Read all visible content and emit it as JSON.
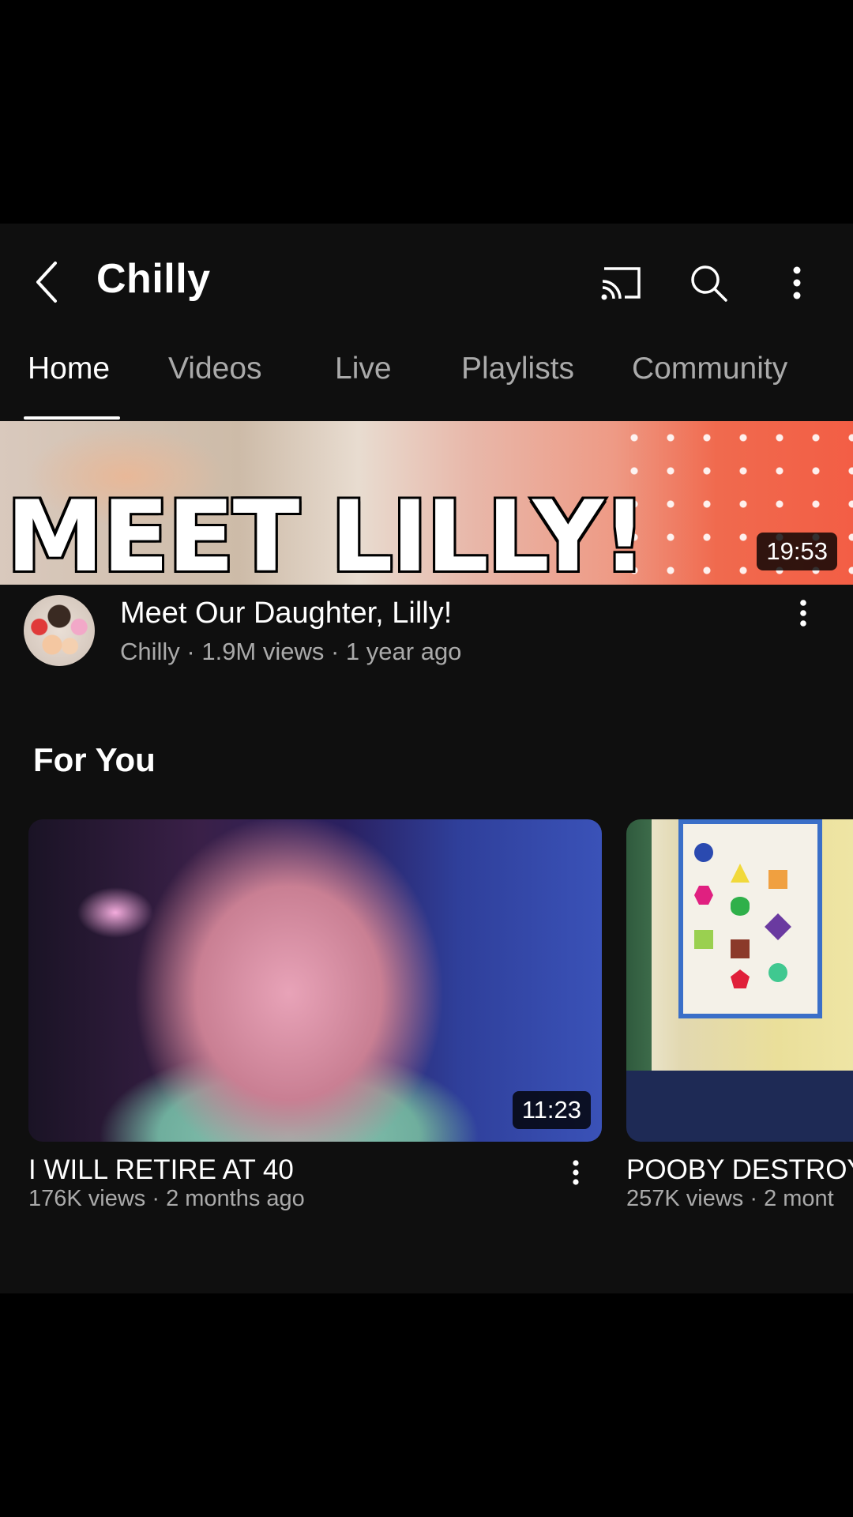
{
  "header": {
    "title": "Chilly",
    "icons": [
      "back-arrow-icon",
      "cast-icon",
      "search-icon",
      "more-vert-icon"
    ]
  },
  "tabs": [
    {
      "label": "Home",
      "active": true
    },
    {
      "label": "Videos",
      "active": false
    },
    {
      "label": "Live",
      "active": false
    },
    {
      "label": "Playlists",
      "active": false
    },
    {
      "label": "Community",
      "active": false
    }
  ],
  "featured": {
    "thumbnail_text": "MEET LILLY!",
    "duration": "19:53",
    "title": "Meet Our Daughter, Lilly!",
    "meta": "Chilly · 1.9M views · 1 year ago"
  },
  "section": {
    "title": "For You",
    "items": [
      {
        "duration": "11:23",
        "title": "I WILL RETIRE AT 40",
        "meta": "176K views · 2 months ago"
      },
      {
        "title": "POOBY DESTROY",
        "meta": "257K views · 2 mont"
      }
    ]
  },
  "colors": {
    "background": "#0f0f0f",
    "text": "#ffffff",
    "secondary": "#aaaaaa"
  }
}
